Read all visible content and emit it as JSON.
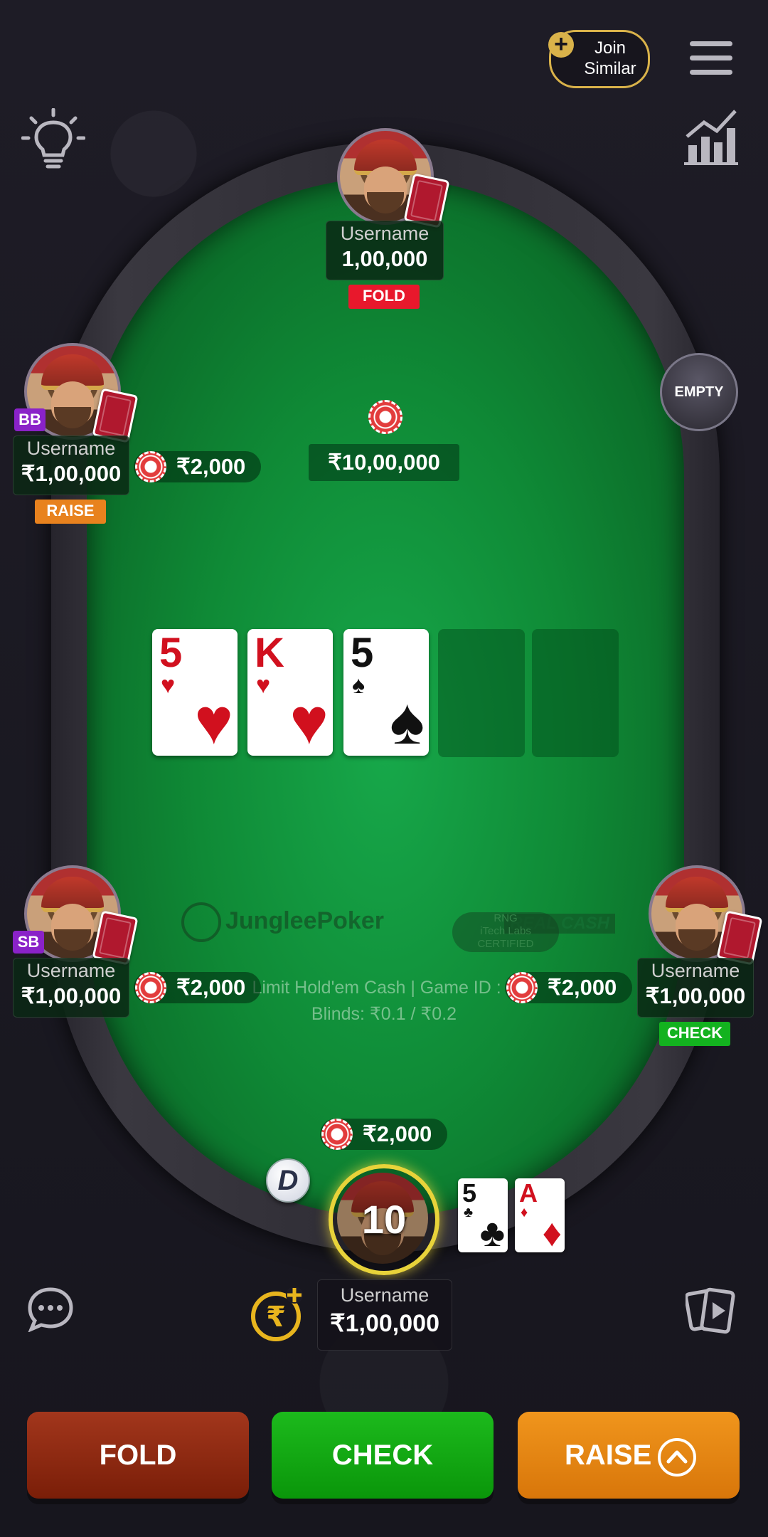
{
  "top_bar": {
    "join_similar_label_1": "Join",
    "join_similar_label_2": "Similar"
  },
  "pot": {
    "amount": "₹10,00,000"
  },
  "players": {
    "top": {
      "name": "Username",
      "stack": "1,00,000",
      "action": "FOLD"
    },
    "left_upper": {
      "name": "Username",
      "stack": "₹1,00,000",
      "action": "RAISE",
      "role": "BB",
      "bet": "₹2,000"
    },
    "right_upper": {
      "status": "EMPTY"
    },
    "left_lower": {
      "name": "Username",
      "stack": "₹1,00,000",
      "role": "SB",
      "bet": "₹2,000"
    },
    "right_lower": {
      "name": "Username",
      "stack": "₹1,00,000",
      "action": "CHECK",
      "bet": "₹2,000"
    },
    "hero": {
      "name": "Username",
      "stack": "₹1,00,000",
      "timer": "10",
      "bet": "₹2,000",
      "dealer_button": "D"
    }
  },
  "community_cards": [
    {
      "rank": "5",
      "suit": "♥",
      "color": "red"
    },
    {
      "rank": "K",
      "suit": "♥",
      "color": "red"
    },
    {
      "rank": "5",
      "suit": "♠",
      "color": "black"
    }
  ],
  "hero_cards": [
    {
      "rank": "5",
      "suit": "♣",
      "color": "black"
    },
    {
      "rank": "A",
      "suit": "♦",
      "color": "red"
    }
  ],
  "table_info": {
    "brand": "JungleePoker",
    "brand_sub": "REAL CASH",
    "cert_1": "RNG",
    "cert_2": "iTech Labs",
    "cert_3": "CERTIFIED",
    "game_line": "Limit Hold'em Cash | Game ID : 8",
    "blinds": "Blinds: ₹0.1 / ₹0.2"
  },
  "actions": {
    "fold": "FOLD",
    "check": "CHECK",
    "raise": "RAISE"
  },
  "colors": {
    "fold": "#8a2410",
    "check": "#16a316",
    "raise": "#e8850e",
    "felt": "#0f8a36"
  }
}
